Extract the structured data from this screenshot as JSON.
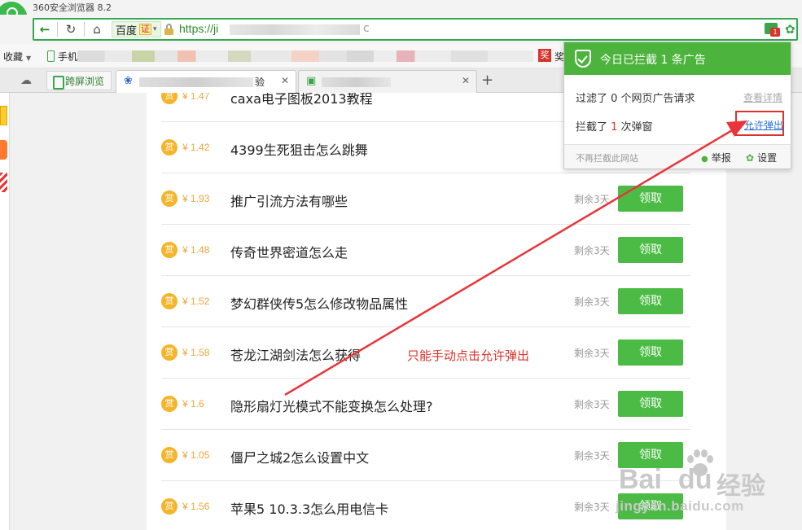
{
  "browser": {
    "app_title": "360安全浏览器 8.2",
    "search_engine": "百度",
    "engine_badge": "证",
    "url_prefix": "https://ji",
    "url_suffix": "c",
    "bookmarks_label": "收藏",
    "bookmark_phone": "手机",
    "bookmark_jiang_icon": "奖",
    "bookmark_jiang_label": "奖",
    "tab_kuaping": "跨屏浏览",
    "tab_active_label": "验",
    "new_tab": "+",
    "adblock_count": "1"
  },
  "popup": {
    "title": "今日已拦截  1 条广告",
    "filtered_prefix": "过滤了 ",
    "filtered_count": "0",
    "filtered_suffix": " 个网页广告请求",
    "view_details": "查看详情",
    "blocked_prefix": "拦截了 ",
    "blocked_count": "1",
    "blocked_suffix": " 次弹窗",
    "allow_popup": "允许弹出",
    "no_block_site": "不再拦截此网站",
    "report": "举报",
    "settings": "设置"
  },
  "questions": [
    {
      "reward_icon": "赏",
      "price": "¥ 1.47",
      "title": "caxa电子图板2013教程",
      "remaining": "剩余3天",
      "claim": "领取"
    },
    {
      "reward_icon": "赏",
      "price": "¥ 1.42",
      "title": "4399生死狙击怎么跳舞",
      "remaining": "剩余3天",
      "claim": "领取"
    },
    {
      "reward_icon": "赏",
      "price": "¥ 1.93",
      "title": "推广引流方法有哪些",
      "remaining": "剩余3天",
      "claim": "领取"
    },
    {
      "reward_icon": "赏",
      "price": "¥ 1.48",
      "title": "传奇世界密道怎么走",
      "remaining": "剩余3天",
      "claim": "领取"
    },
    {
      "reward_icon": "赏",
      "price": "¥ 1.52",
      "title": "梦幻群侠传5怎么修改物品属性",
      "remaining": "剩余3天",
      "claim": "领取"
    },
    {
      "reward_icon": "赏",
      "price": "¥ 1.58",
      "title": "苍龙江湖剑法怎么获得",
      "remaining": "剩余3天",
      "claim": "领取"
    },
    {
      "reward_icon": "赏",
      "price": "¥ 1.6",
      "title": "隐形扇灯光模式不能变换怎么处理?",
      "remaining": "剩余3天",
      "claim": "领取"
    },
    {
      "reward_icon": "赏",
      "price": "¥ 1.05",
      "title": "僵尸之城2怎么设置中文",
      "remaining": "剩余3天",
      "claim": "领取"
    },
    {
      "reward_icon": "赏",
      "price": "¥ 1.56",
      "title": "苹果5 10.3.3怎么用电信卡",
      "remaining": "剩余3天",
      "claim": "领取"
    }
  ],
  "annotation": "只能手动点击允许弹出",
  "watermark": {
    "logo": "Bai",
    "logo_tail": "du",
    "text": "经验",
    "url": "jingyan.baidu.com"
  },
  "colors": {
    "accent_green": "#4cbb45",
    "popup_green": "#4cb43c",
    "annotation_red": "#d9342b",
    "price_orange": "#f0a43a"
  }
}
